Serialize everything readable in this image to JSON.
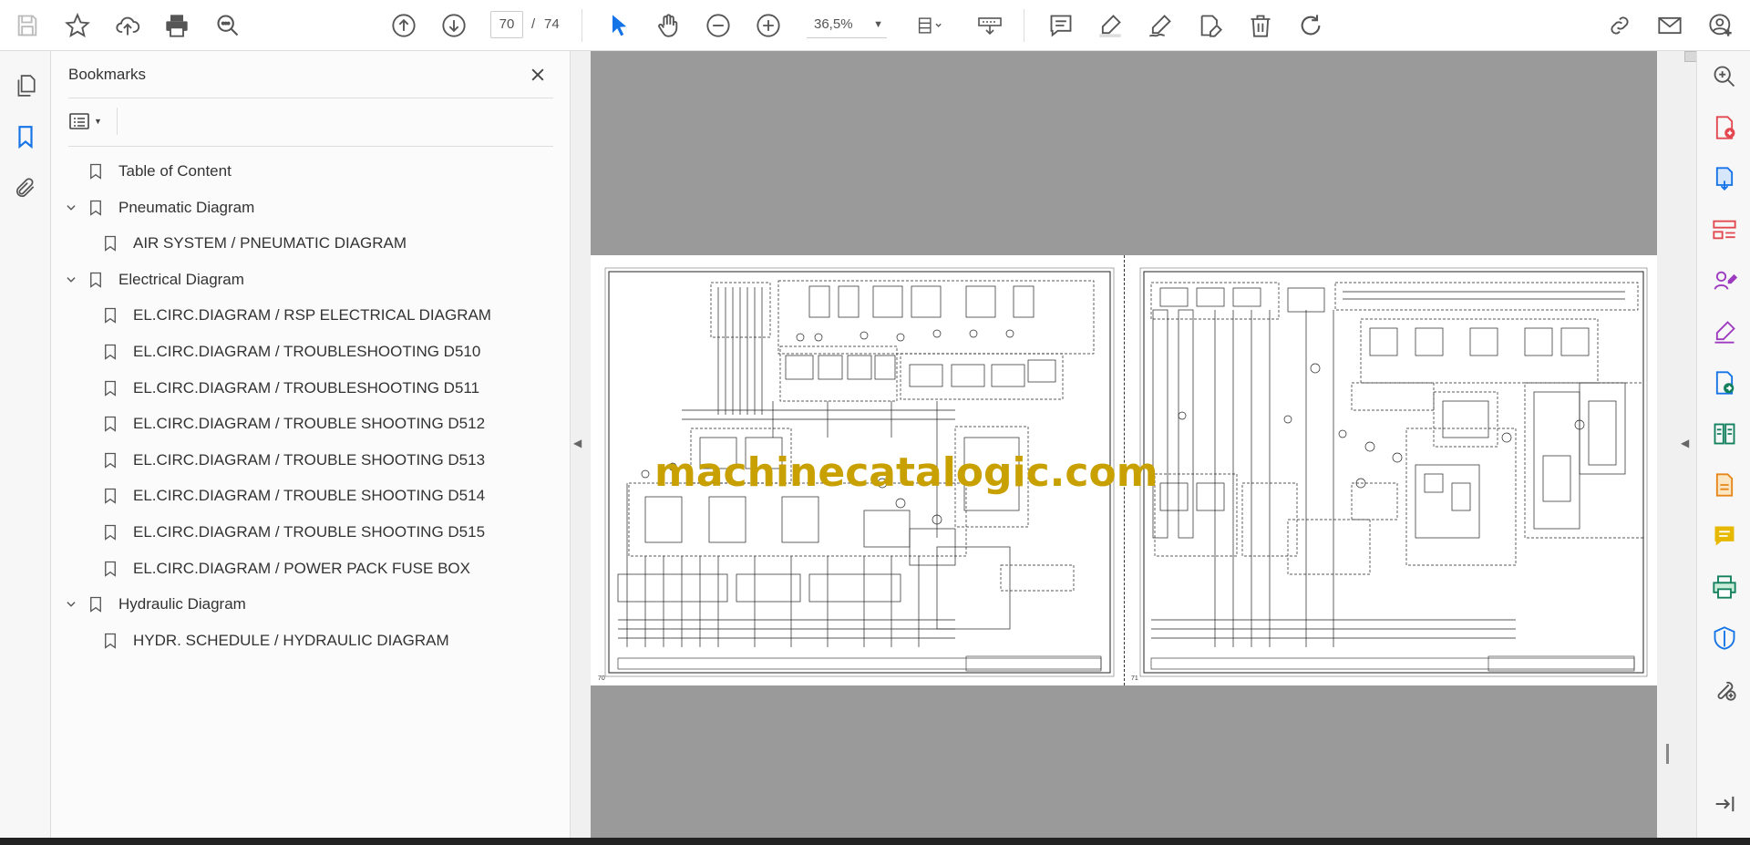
{
  "toolbar": {
    "icons": [
      "save-icon",
      "bookmark-star-icon",
      "upload-icon",
      "print-icon",
      "find-icon",
      "prev-page-icon",
      "next-page-icon",
      "select-icon",
      "hand-icon",
      "zoom-out-icon",
      "zoom-in-icon",
      "fit-page-icon",
      "scroll-mode-icon",
      "comment-icon",
      "highlight-icon",
      "draw-icon",
      "edit-icon",
      "delete-icon",
      "rotate-icon",
      "share-link-icon",
      "email-icon",
      "account-icon"
    ],
    "current_page": "70",
    "page_separator": "/",
    "total_pages": "74",
    "zoom": "36,5%",
    "accent_color": "#1473e6"
  },
  "left_rail": {
    "icons": [
      "page-thumbnails-icon",
      "bookmarks-icon",
      "attachments-icon"
    ]
  },
  "bookmarks": {
    "title": "Bookmarks",
    "items": [
      {
        "label": "Table of Content",
        "level": 0,
        "expandable": false
      },
      {
        "label": "Pneumatic Diagram",
        "level": 0,
        "expandable": true
      },
      {
        "label": "AIR SYSTEM / PNEUMATIC DIAGRAM",
        "level": 1,
        "expandable": false
      },
      {
        "label": "Electrical Diagram",
        "level": 0,
        "expandable": true
      },
      {
        "label": "EL.CIRC.DIAGRAM / RSP ELECTRICAL DIAGRAM",
        "level": 1,
        "expandable": false
      },
      {
        "label": "EL.CIRC.DIAGRAM / TROUBLESHOOTING D510",
        "level": 1,
        "expandable": false
      },
      {
        "label": "EL.CIRC.DIAGRAM / TROUBLESHOOTING D511",
        "level": 1,
        "expandable": false
      },
      {
        "label": "EL.CIRC.DIAGRAM / TROUBLE SHOOTING D512",
        "level": 1,
        "expandable": false
      },
      {
        "label": "EL.CIRC.DIAGRAM / TROUBLE SHOOTING D513",
        "level": 1,
        "expandable": false
      },
      {
        "label": "EL.CIRC.DIAGRAM / TROUBLE SHOOTING D514",
        "level": 1,
        "expandable": false
      },
      {
        "label": "EL.CIRC.DIAGRAM / TROUBLE SHOOTING D515",
        "level": 1,
        "expandable": false
      },
      {
        "label": "EL.CIRC.DIAGRAM / POWER PACK FUSE BOX",
        "level": 1,
        "expandable": false
      },
      {
        "label": "Hydraulic Diagram",
        "level": 0,
        "expandable": true
      },
      {
        "label": "HYDR. SCHEDULE / HYDRAULIC DIAGRAM",
        "level": 1,
        "expandable": false
      }
    ]
  },
  "document": {
    "watermark": "machinecatalogic.com",
    "left_page_number": "70",
    "right_page_number": "71"
  },
  "right_rail": {
    "icons": [
      "zoom-search-icon",
      "create-pdf-icon",
      "export-pdf-icon",
      "organize-pages-icon",
      "fill-sign-icon",
      "request-signature-icon",
      "send-for-review-icon",
      "compare-icon",
      "protect-doc-icon",
      "comment-tool-icon",
      "print-production-icon",
      "protect-icon",
      "more-tools-icon",
      "expand-panel-icon"
    ]
  }
}
